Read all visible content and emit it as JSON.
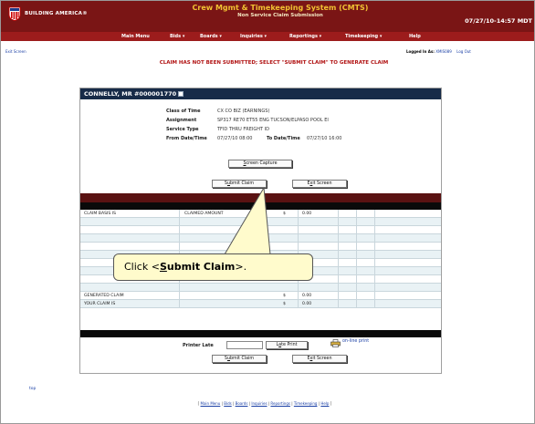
{
  "header": {
    "brand": "BUILDING AMERICA®",
    "title": "Crew Mgmt & Timekeeping System (CMTS)",
    "subtitle": "Non Service Claim Submission",
    "datetime": "07/27/10-14:57 MDT",
    "logo_icon": "union-pacific-shield-icon",
    "colors": {
      "header_bg": "#7a1515",
      "menu_bg": "#9c1c1c",
      "title": "#f1c232"
    }
  },
  "menu": {
    "items": [
      {
        "label": "Main Menu"
      },
      {
        "label": "Bids ▾"
      },
      {
        "label": "Boards ▾"
      },
      {
        "label": "Inquiries ▾"
      },
      {
        "label": "Reportings ▾"
      },
      {
        "label": "Timekeeping ▾"
      },
      {
        "label": "Help"
      }
    ]
  },
  "topbar": {
    "exit_link": "Exit Screen",
    "logged_label": "Logged In As:",
    "user_id": "XMIS089",
    "logout": "Log Out"
  },
  "warning": "CLAIM HAS NOT BEEN SUBMITTED; SELECT \"SUBMIT CLAIM\" TO GENERATE CLAIM",
  "employee": {
    "name": "CONNELLY, MR #000001770",
    "info_icon": "info-icon"
  },
  "details": {
    "class_label": "Class of Time",
    "class_value": "CX CO BIZ (EARNINGS)",
    "assignment_label": "Assignment",
    "assignment_value": "SP317 RE70 ET55 ENG TUCSON/ELPASO POOL EI",
    "service_label": "Service Type",
    "service_value": "TFID THRU FREIGHT ID",
    "from_label": "From Date/Time",
    "from_value": "07/27/10 08:00",
    "to_label": "To Date/Time",
    "to_value": "07/27/10 16:00"
  },
  "buttons": {
    "screen_capture_acc": "S",
    "screen_capture_rest": "creen Capture",
    "submit_pre": "S",
    "submit_acc": "u",
    "submit_rest": "bmit Claim",
    "exit_pre": "E",
    "exit_acc": "x",
    "exit_rest": "it Screen",
    "late_print_pre": "L",
    "late_print_acc": "a",
    "late_print_rest": "te Print"
  },
  "table": {
    "basis_label": "CLAIM BASIS IS",
    "claimed_label": "CLAIMED AMOUNT",
    "currency": "$",
    "basis_amount": "0.00",
    "generated_label": "GENERATED CLAIM",
    "generated_amount": "0.00",
    "your_claim_label": "YOUR CLAIM IS",
    "your_claim_amount": "0.00"
  },
  "printer": {
    "label": "Printer Late",
    "input_value": "",
    "online_print": "on-line print",
    "printer_icon": "printer-icon"
  },
  "callout": {
    "prefix": "Click <",
    "acc": "S",
    "bold": "ubmit Claim",
    "suffix": ">."
  },
  "footer": {
    "top_link": "top",
    "open": "[ ",
    "close": " ]",
    "sep": " | ",
    "links": [
      "Main Menu",
      "Bids",
      "Boards",
      "Inquiries",
      "Reportings",
      "Timekeeping",
      "Help"
    ]
  }
}
